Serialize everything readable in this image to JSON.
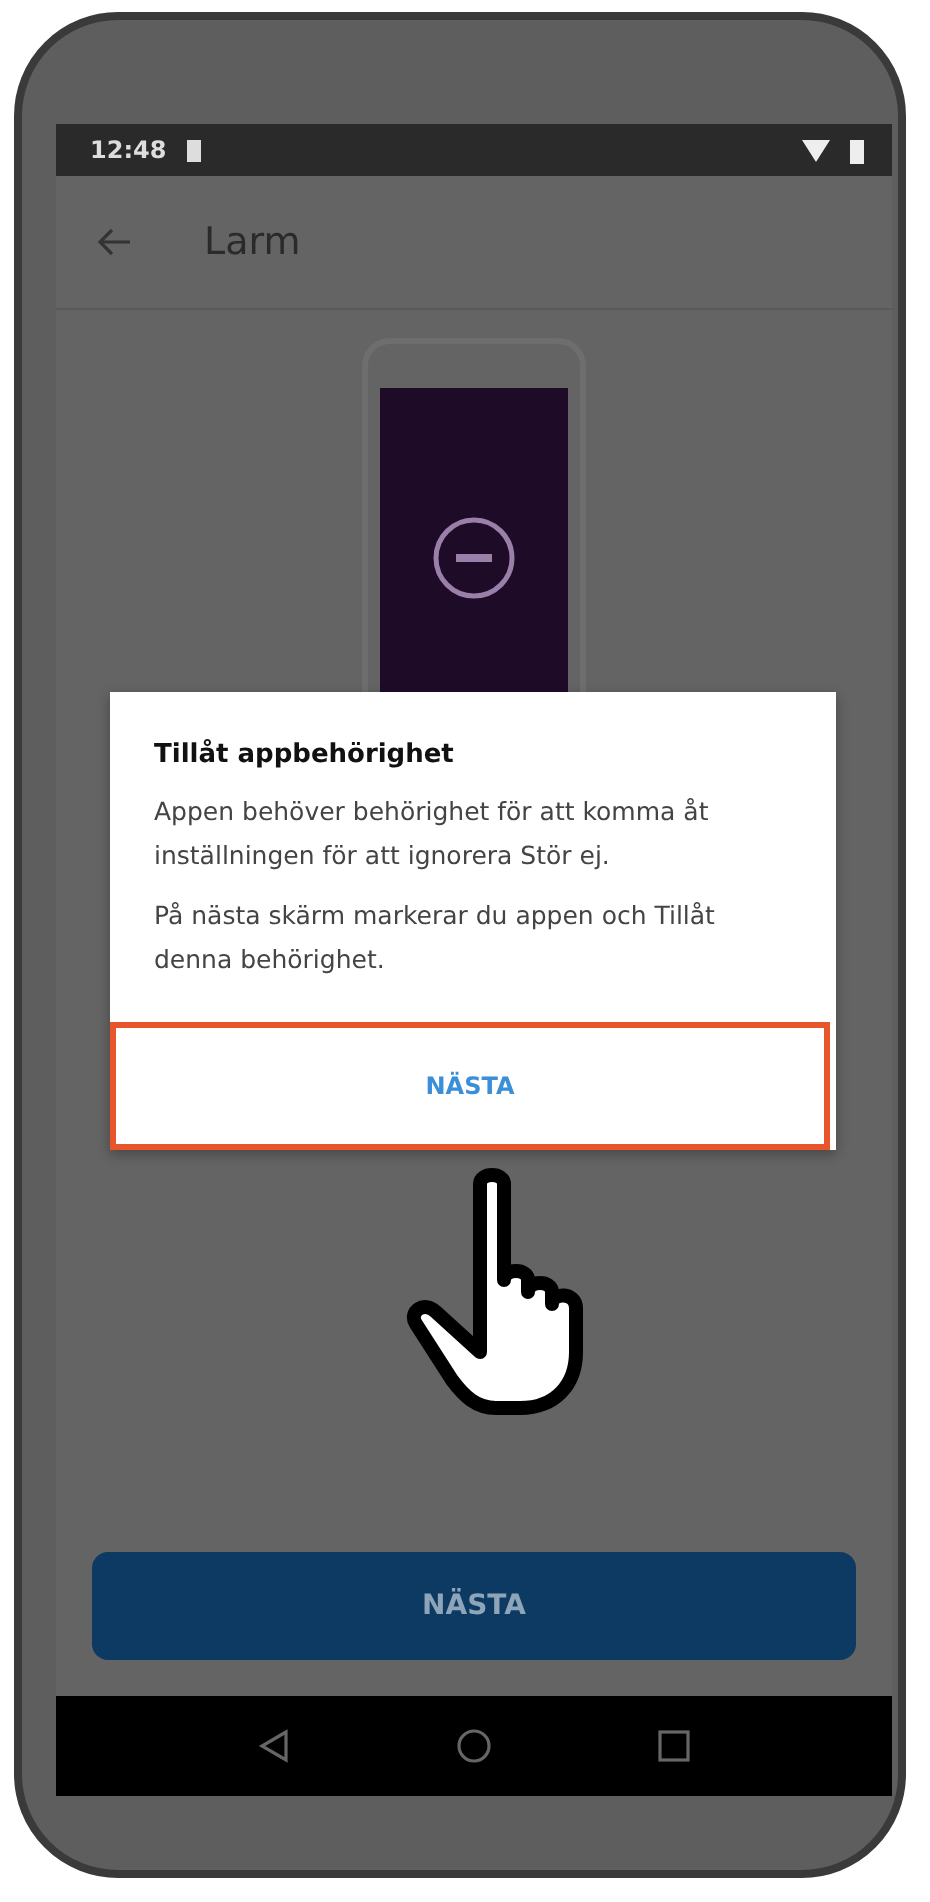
{
  "status_bar": {
    "time": "12:48"
  },
  "app_bar": {
    "title": "Larm"
  },
  "dialog": {
    "title": "Tillåt appbehörighet",
    "paragraphs": [
      "Appen behöver behörighet för att komma åt inställningen för att ignorera Stör ej.",
      "På nästa skärm markerar du appen och Tillåt denna behörighet."
    ],
    "button": {
      "label": "NÄSTA",
      "highlighted": true
    }
  },
  "primary_button": {
    "label": "NÄSTA"
  }
}
